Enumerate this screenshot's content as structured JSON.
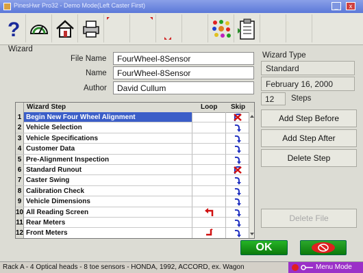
{
  "window": {
    "title": "PinesHwr Pro32 - Demo Mode(Left Caster First)",
    "min_label": "_",
    "close_label": "x"
  },
  "toolbar": {
    "buttons": [
      {
        "icon": "help-question-icon"
      },
      {
        "icon": "gauge-icon"
      },
      {
        "icon": "home-icon"
      },
      {
        "icon": "printer-icon"
      },
      {
        "icon": "blank"
      },
      {
        "icon": "blank"
      },
      {
        "icon": "blank"
      },
      {
        "icon": "blank"
      },
      {
        "icon": "color-dots-icon"
      },
      {
        "icon": "clipboard-icon"
      },
      {
        "icon": "blank"
      },
      {
        "icon": "blank"
      }
    ]
  },
  "wizard": {
    "group_label": "Wizard",
    "file_name_label": "File Name",
    "file_name_value": "FourWheel-8Sensor",
    "name_label": "Name",
    "name_value": "FourWheel-8Sensor",
    "author_label": "Author",
    "author_value": "David Cullum"
  },
  "wizard_type": {
    "label": "Wizard Type",
    "value": "Standard",
    "date": "February 16, 2000",
    "steps_count": "12",
    "steps_label": "Steps"
  },
  "actions": {
    "add_before": "Add Step Before",
    "add_after": "Add Step After",
    "delete_step": "Delete Step",
    "delete_file": "Delete File"
  },
  "table": {
    "columns": {
      "step": "Wizard Step",
      "loop": "Loop",
      "skip": "Skip"
    },
    "rows": [
      {
        "num": "1",
        "name": "Begin New Four Wheel Alignment",
        "loop": "",
        "skip": "x",
        "selected": true
      },
      {
        "num": "2",
        "name": "Vehicle Selection",
        "loop": "",
        "skip": "arrow"
      },
      {
        "num": "3",
        "name": "Vehicle Specifications",
        "loop": "",
        "skip": "arrow"
      },
      {
        "num": "4",
        "name": "Customer Data",
        "loop": "",
        "skip": "arrow"
      },
      {
        "num": "5",
        "name": "Pre-Alignment Inspection",
        "loop": "",
        "skip": "arrow"
      },
      {
        "num": "6",
        "name": "Standard Runout",
        "loop": "",
        "skip": "x"
      },
      {
        "num": "7",
        "name": "Caster Swing",
        "loop": "",
        "skip": "arrow"
      },
      {
        "num": "8",
        "name": "Calibration Check",
        "loop": "",
        "skip": "arrow"
      },
      {
        "num": "9",
        "name": "Vehicle Dimensions",
        "loop": "",
        "skip": "arrow"
      },
      {
        "num": "10",
        "name": "All Reading Screen",
        "loop": "up",
        "skip": "arrow"
      },
      {
        "num": "11",
        "name": "Rear Meters",
        "loop": "",
        "skip": "arrow"
      },
      {
        "num": "12",
        "name": "Front Meters",
        "loop": "down",
        "skip": "arrow"
      }
    ]
  },
  "footer": {
    "ok_label": "OK",
    "status_text": "Rack A - 4 Optical heads - 8 toe sensors - HONDA, 1992, ACCORD, ex. Wagon",
    "mode_label": "Menu Mode"
  }
}
